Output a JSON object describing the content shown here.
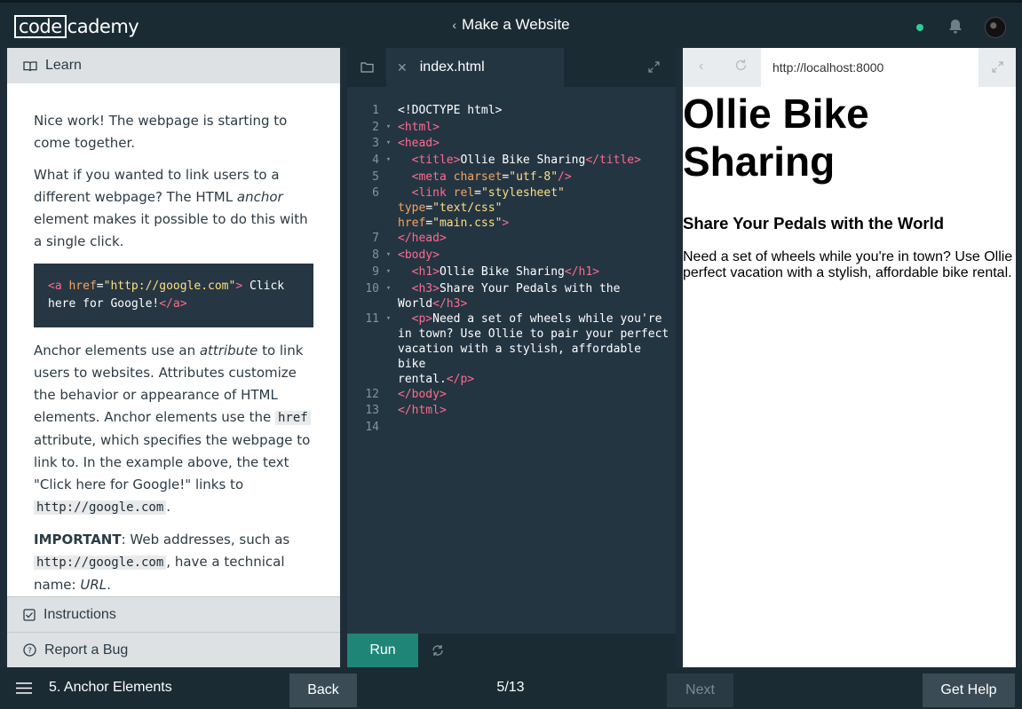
{
  "header": {
    "logo_box": "code",
    "logo_rest": "cademy",
    "course_title": "Make a Website"
  },
  "learn": {
    "tab_label": "Learn",
    "p1": "Nice work! The webpage is starting to come together.",
    "p2_a": "What if you wanted to link users to a different webpage? The HTML ",
    "p2_em": "anchor",
    "p2_b": " element makes it possible to do this with a single click.",
    "code_block": {
      "open_tag": "<a",
      "attr": " href",
      "eq": "=",
      "value": "\"http://google.com\"",
      "close_bracket": ">",
      "text": " Click here for Google!",
      "end_tag": "</a>"
    },
    "p3_a": "Anchor elements use an ",
    "p3_em": "attribute",
    "p3_b": " to link users to websites. Attributes customize the behavior or appearance of HTML elements. Anchor elements use the ",
    "p3_code": "href",
    "p3_c": " attribute, which specifies the webpage to link to. In the example above, the text \"Click here for Google!\" links to ",
    "p3_code2": "http://google.com",
    "p3_d": ".",
    "p4_strong": "IMPORTANT",
    "p4_a": ": Web addresses, such as ",
    "p4_code": "http://google.com",
    "p4_b": ", have a technical name: ",
    "p4_em": "URL",
    "p4_c": ".",
    "instructions_label": "Instructions",
    "report_label": "Report a Bug"
  },
  "editor": {
    "file_name": "index.html",
    "run_label": "Run",
    "lines": [
      {
        "n": "1",
        "fold": "",
        "html": "&lt;!DOCTYPE html&gt;"
      },
      {
        "n": "2",
        "fold": "▾",
        "html": "<span class='tag'>&lt;html&gt;</span>"
      },
      {
        "n": "3",
        "fold": "▾",
        "html": "<span class='tag'>&lt;head&gt;</span>"
      },
      {
        "n": "4",
        "fold": "▾",
        "html": "  <span class='tag'>&lt;title&gt;</span>Ollie Bike Sharing<span class='tag'>&lt;/title&gt;</span>"
      },
      {
        "n": "5",
        "fold": "",
        "html": "  <span class='tag'>&lt;meta</span> <span class='attr'>charset</span>=<span class='str'>\"utf-8\"</span><span class='tag'>/&gt;</span>"
      },
      {
        "n": "6",
        "fold": "",
        "html": "  <span class='tag'>&lt;link</span> <span class='attr'>rel</span>=<span class='str'>\"stylesheet\"</span> <span class='attr'>type</span>=<span class='str'>\"text/css\"</span>\n<span class='attr'>href</span>=<span class='str'>\"main.css\"</span><span class='tag'>&gt;</span>"
      },
      {
        "n": "7",
        "fold": "",
        "html": "<span class='tag'>&lt;/head&gt;</span>"
      },
      {
        "n": "8",
        "fold": "▾",
        "html": "<span class='tag'>&lt;body&gt;</span>"
      },
      {
        "n": "9",
        "fold": "▾",
        "html": "  <span class='tag'>&lt;h1&gt;</span>Ollie Bike Sharing<span class='tag'>&lt;/h1&gt;</span>"
      },
      {
        "n": "10",
        "fold": "▾",
        "html": "  <span class='tag'>&lt;h3&gt;</span>Share Your Pedals with the\nWorld<span class='tag'>&lt;/h3&gt;</span>"
      },
      {
        "n": "11",
        "fold": "▾",
        "html": "  <span class='tag'>&lt;p&gt;</span>Need a set of wheels while you're\nin town? Use Ollie to pair your perfect\nvacation with a stylish, affordable bike\nrental.<span class='tag'>&lt;/p&gt;</span>"
      },
      {
        "n": "12",
        "fold": "",
        "html": "<span class='tag'>&lt;/body&gt;</span>"
      },
      {
        "n": "13",
        "fold": "",
        "html": "<span class='tag'>&lt;/html&gt;</span>"
      },
      {
        "n": "14",
        "fold": "",
        "html": ""
      }
    ]
  },
  "browser": {
    "url": "http://localhost:8000",
    "h1": "Ollie Bike Sharing",
    "h3": "Share Your Pedals with the World",
    "p_line1": "Need a set of wheels while you're in town? Use Ollie",
    "p_line2": "perfect vacation with a stylish, affordable bike rental."
  },
  "footer": {
    "lesson_title": "5. Anchor Elements",
    "back_label": "Back",
    "progress": "5/13",
    "next_label": "Next",
    "help_label": "Get Help"
  },
  "colors": {
    "run_button": "#1f8577",
    "status_dot": "#2ecc9a"
  }
}
